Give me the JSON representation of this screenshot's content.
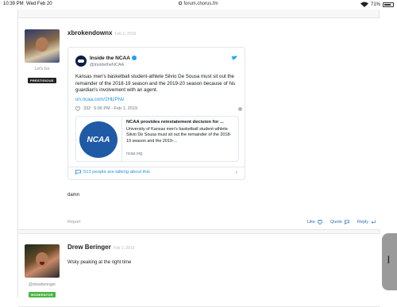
{
  "status_bar": {
    "time": "10:39 PM",
    "date": "Wed Feb 20",
    "url": "forum.chorus.fm",
    "battery": "71%"
  },
  "posts": [
    {
      "username": "xbrokendownx",
      "date": "Feb 1, 2019",
      "user_title": "Let's Go",
      "badge": "PRESTIGIOUS",
      "body": "damn",
      "tweet": {
        "name": "Inside the NCAA",
        "handle": "@InsidetheNCAA",
        "text": "Kansas men's basketball student-athlete Silvio De Sousa must sit out the remainder of the 2018-19 season and the 2019-20 season because of his guardian's involvement with an agent.",
        "link": "on.ncaa.com/2HlzPNv",
        "likes": "332",
        "time": "5:06 PM - Feb 1, 2019",
        "card": {
          "logo_text": "NCAA",
          "title": "NCAA provides reinstatement decision for ...",
          "description": "University of Kansas men's basketball student-athlete Silvio De Sousa must sit out the remainder of the 2018-19 season and the 2019-...",
          "domain": "ncaa.org"
        },
        "people_talking": "513 people are talking about this"
      },
      "footer": {
        "report": "Report",
        "like": "Like",
        "quote": "Quote",
        "reply": "Reply"
      }
    },
    {
      "username": "Drew Beringer",
      "date": "Feb 1, 2019",
      "user_title": "@drewberinger",
      "badge": "MODERATOR",
      "body": "Wsky peaking at the right time"
    }
  ],
  "colors": {
    "link_blue": "#1b95e0",
    "action_blue": "#2a6ebb",
    "moderator_green": "#4bb543",
    "prestigious_black": "#222222"
  },
  "icons": [
    "lock-icon",
    "wifi-icon",
    "battery-icon",
    "verified-icon",
    "twitter-bird-icon",
    "heart-icon",
    "info-icon",
    "comment-icon",
    "chevron-right-icon",
    "like-icon",
    "quote-icon",
    "reply-icon"
  ]
}
